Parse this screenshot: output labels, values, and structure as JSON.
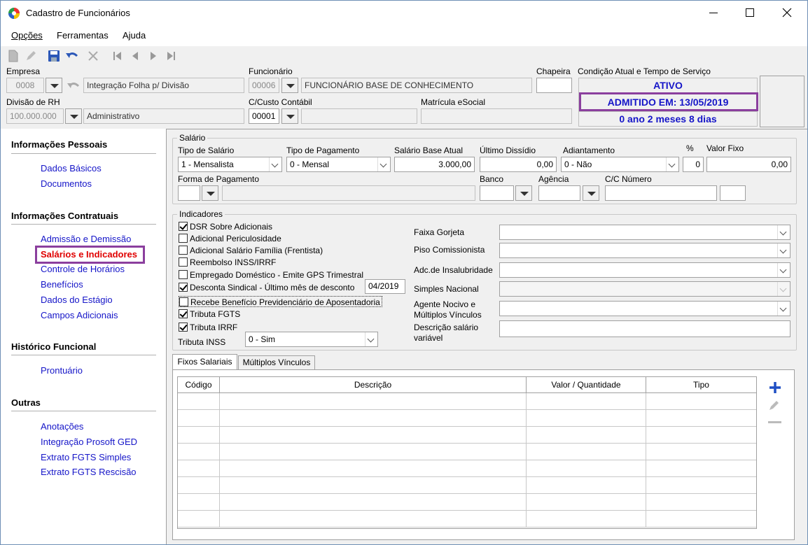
{
  "window": {
    "title": "Cadastro de Funcionários"
  },
  "menu": [
    "Opções",
    "Ferramentas",
    "Ajuda"
  ],
  "header": {
    "empresa_label": "Empresa",
    "empresa_code": "0008",
    "empresa_name": "Integração Folha p/ Divisão",
    "divisao_label": "Divisão de RH",
    "divisao_code": "100.000.000",
    "divisao_name": "Administrativo",
    "funcionario_label": "Funcionário",
    "funcionario_code": "00006",
    "funcionario_name": "FUNCIONÁRIO BASE DE CONHECIMENTO",
    "custo_label": "C/Custo Contábil",
    "custo_code": "00001",
    "matricula_label": "Matrícula eSocial",
    "chapeira_label": "Chapeira",
    "condicao_label": "Condição Atual e Tempo de Serviço",
    "status": "ATIVO",
    "admitido": "ADMITIDO EM: 13/05/2019",
    "tempo": "0 ano 2 meses 8 dias"
  },
  "sidebar": {
    "sections": [
      {
        "title": "Informações Pessoais",
        "items": [
          "Dados Básicos",
          "Documentos"
        ]
      },
      {
        "title": "Informações Contratuais",
        "items": [
          "Admissão e Demissão",
          "Salários e Indicadores",
          "Controle de Horários",
          "Benefícios",
          "Dados do Estágio",
          "Campos Adicionais"
        ]
      },
      {
        "title": "Histórico Funcional",
        "items": [
          "Prontuário"
        ]
      },
      {
        "title": "Outras",
        "items": [
          "Anotações",
          "Integração Prosoft GED",
          "Extrato FGTS Simples",
          "Extrato FGTS Rescisão"
        ]
      }
    ],
    "active_color": "#e00000"
  },
  "salario": {
    "group": "Salário",
    "tipo_label": "Tipo de Salário",
    "tipo_value": "1 - Mensalista",
    "pagamento_label": "Tipo de Pagamento",
    "pagamento_value": "0 - Mensal",
    "base_label": "Salário Base Atual",
    "base_value": "3.000,00",
    "dissidio_label": "Último Dissídio",
    "dissidio_value": "0,00",
    "adiant_label": "Adiantamento",
    "adiant_value": "0 - Não",
    "pct_label": "%",
    "pct_value": "0",
    "fixo_label": "Valor Fixo",
    "fixo_value": "0,00",
    "forma_label": "Forma de Pagamento",
    "banco_label": "Banco",
    "agencia_label": "Agência",
    "cc_label": "C/C Número"
  },
  "indicadores": {
    "group": "Indicadores",
    "checks": [
      {
        "label": "DSR Sobre Adicionais",
        "checked": true
      },
      {
        "label": "Adicional Periculosidade",
        "checked": false
      },
      {
        "label": "Adicional Salário Família (Frentista)",
        "checked": false
      },
      {
        "label": "Reembolso INSS/IRRF",
        "checked": false
      },
      {
        "label": "Empregado Doméstico - Emite GPS Trimestral",
        "checked": false
      },
      {
        "label": "Desconta Sindical - Último mês de desconto",
        "checked": true
      },
      {
        "label": "Recebe Benefício Previdenciário de Aposentadoria",
        "checked": false
      },
      {
        "label": "Tributa FGTS",
        "checked": true
      },
      {
        "label": "Tributa IRRF",
        "checked": true
      }
    ],
    "sindical_mes": "04/2019",
    "inss_label": "Tributa INSS",
    "inss_value": "0 - Sim",
    "faixa_label": "Faixa Gorjeta",
    "piso_label": "Piso Comissionista",
    "insal_label": "Adc.de Insalubridade",
    "simples_label": "Simples Nacional",
    "agente_label1": "Agente Nocivo e",
    "agente_label2": "Múltiplos Vínculos",
    "desc_label1": "Descrição salário",
    "desc_label2": "variável"
  },
  "tabs": [
    "Fixos Salariais",
    "Múltiplos Vínculos"
  ],
  "table": {
    "columns": [
      "Código",
      "Descrição",
      "Valor / Quantidade",
      "Tipo"
    ]
  },
  "colors": {
    "accent": "#1515c8",
    "highlight": "#8b3f9e",
    "link": "#1515c8"
  }
}
